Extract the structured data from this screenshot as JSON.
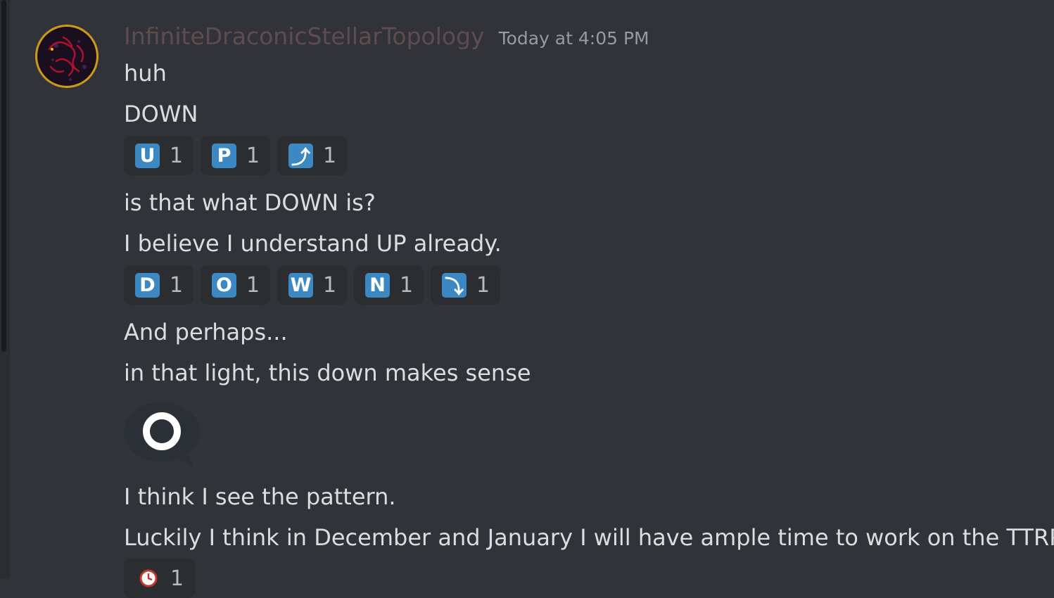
{
  "message": {
    "username": "InfiniteDraconicStellarTopology",
    "timestamp": "Today at 4:05 PM",
    "lines": {
      "l1": "huh",
      "l2": "DOWN",
      "l3": "is that what DOWN is?",
      "l4": "I believe I understand UP already.",
      "l5": "And perhaps...",
      "l6": "in that light, this down makes sense",
      "l7": "I think I see the pattern.",
      "l8": "Luckily I think in December and January I will have ample time to work on the TTRPG."
    }
  },
  "reactions_up": [
    {
      "emoji": "U",
      "count": "1",
      "icon": "regional-indicator-u-icon"
    },
    {
      "emoji": "P",
      "count": "1",
      "icon": "regional-indicator-p-icon"
    },
    {
      "emoji": "⤴",
      "count": "1",
      "icon": "arrow-up-curved-icon"
    }
  ],
  "reactions_down": [
    {
      "emoji": "D",
      "count": "1",
      "icon": "regional-indicator-d-icon"
    },
    {
      "emoji": "O",
      "count": "1",
      "icon": "regional-indicator-o-icon"
    },
    {
      "emoji": "W",
      "count": "1",
      "icon": "regional-indicator-w-icon"
    },
    {
      "emoji": "N",
      "count": "1",
      "icon": "regional-indicator-n-icon"
    },
    {
      "emoji": "⤵",
      "count": "1",
      "icon": "arrow-down-curved-icon"
    }
  ],
  "last_reaction": {
    "count": "1",
    "icon": "clock-icon"
  },
  "big_emoji": {
    "icon": "speech-bubble-o-icon"
  },
  "colors": {
    "background": "#313338",
    "reaction_bg": "#2b2d31",
    "key_blue": "#3b88c3",
    "username": "#5d4d4e",
    "timestamp": "#949ba4",
    "text": "#dbdee1"
  }
}
